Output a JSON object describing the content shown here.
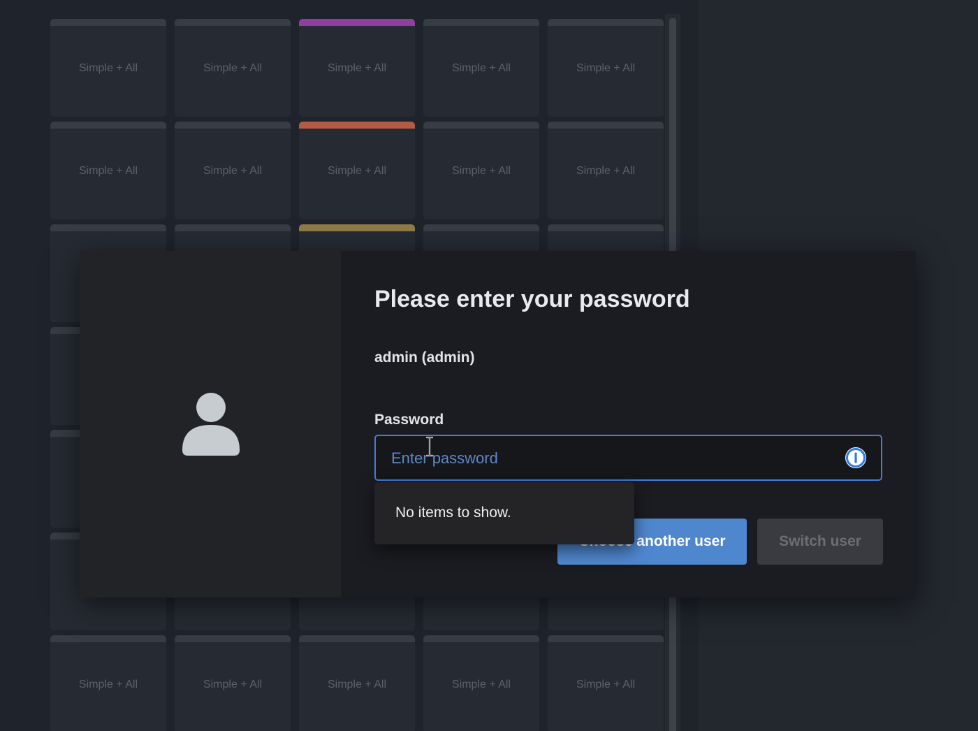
{
  "background": {
    "tile_label": "Simple + All",
    "accent_colors": {
      "magenta": "#8e3fa0",
      "coral": "#b55a43",
      "gold": "#8f7b45",
      "default": "#373c45"
    }
  },
  "dialog": {
    "title": "Please enter your password",
    "user_display": "admin (admin)",
    "password_label": "Password",
    "password_placeholder": "Enter password",
    "password_value": "",
    "autocomplete_message": "No items to show.",
    "choose_user_button": "Choose another user",
    "switch_user_button": "Switch user",
    "colors": {
      "focus_border": "#4a7ad6",
      "primary_button": "#4f87cf",
      "password_manager_icon": "#2d7be5"
    }
  }
}
